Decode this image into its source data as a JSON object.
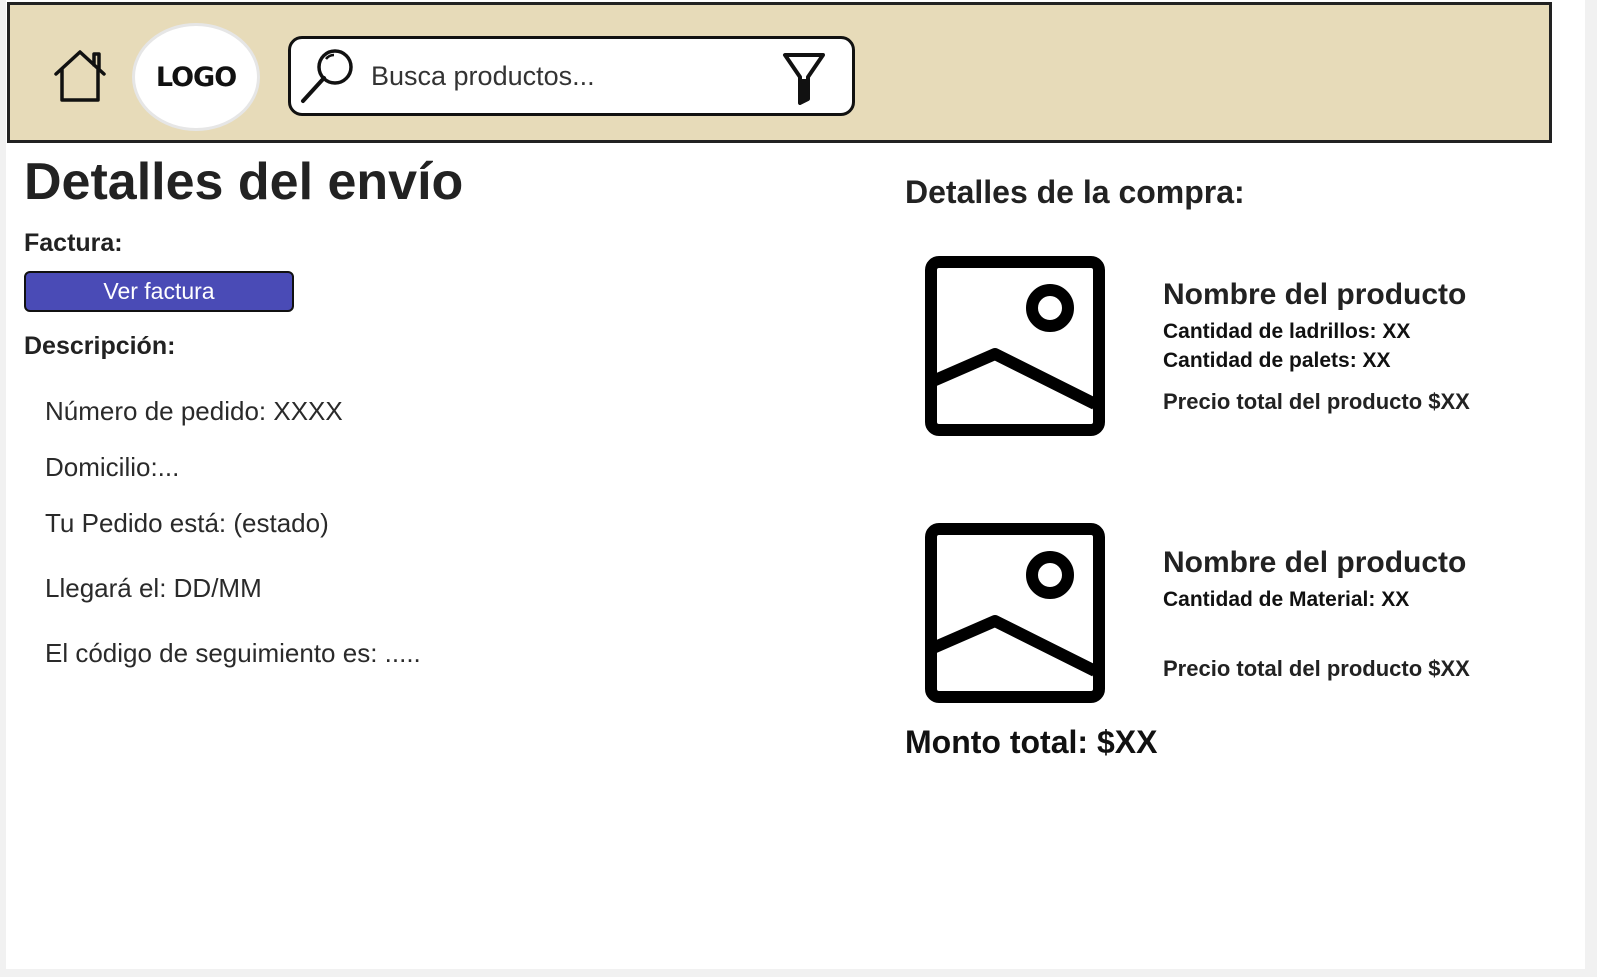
{
  "header": {
    "logo_text": "LOGO",
    "search_placeholder": "Busca productos...",
    "icons": [
      "home-icon",
      "search-icon",
      "filter-icon"
    ],
    "background_color": "#e7dbb9"
  },
  "shipping": {
    "title": "Detalles del envío",
    "invoice_label": "Factura:",
    "invoice_button": "Ver factura",
    "invoice_button_color": "#4a4bb6",
    "description_label": "Descripción:",
    "order_number": "Número de pedido: XXXX",
    "address": "Domicilio:...",
    "status": "Tu Pedido está: (estado)",
    "arrival": "Llegará el: DD/MM",
    "tracking": "El código de seguimiento es: ....."
  },
  "purchase": {
    "title": "Detalles de la compra:",
    "products": [
      {
        "name": "Nombre del producto",
        "details": [
          "Cantidad de ladrillos: XX",
          "Cantidad de palets: XX"
        ],
        "price": "Precio total del producto $XX",
        "image_icon": "image-placeholder-icon"
      },
      {
        "name": "Nombre del producto",
        "details": [
          "Cantidad de Material: XX"
        ],
        "price": "Precio total del producto $XX",
        "image_icon": "image-placeholder-icon"
      }
    ],
    "total": "Monto total: $XX"
  }
}
